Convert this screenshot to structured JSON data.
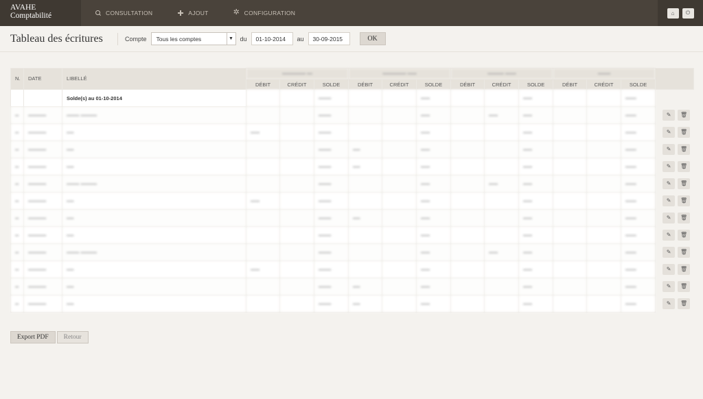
{
  "brand": {
    "line1": "AVAHE",
    "line2": "Comptabilité"
  },
  "nav": [
    {
      "label": "CONSULTATION",
      "icon": "search-icon"
    },
    {
      "label": "AJOUT",
      "icon": "plus-icon"
    },
    {
      "label": "CONFIGURATION",
      "icon": "gear-icon"
    }
  ],
  "toolbar": {
    "title": "Tableau des écritures",
    "compte_label": "Compte",
    "compte_value": "Tous les comptes",
    "du_label": "du",
    "date_from": "01-10-2014",
    "au_label": "au",
    "date_to": "30-09-2015",
    "ok_label": "OK"
  },
  "table": {
    "col_n": "N.",
    "col_date": "DATE",
    "col_libelle": "LIBELLÉ",
    "account_groups": [
      "••••••••••••• •••",
      "••••••••••••• •••••",
      "••••••••• ••••••",
      "•••••••"
    ],
    "sub_cols": [
      "DÉBIT",
      "CRÉDIT",
      "SOLDE"
    ],
    "solde_row_label": "Solde(s) au 01-10-2014",
    "solde_row": [
      "",
      "",
      "•••••••",
      "",
      "",
      "•••••",
      "",
      "",
      "•••••",
      "",
      "",
      "••••••"
    ],
    "rows": [
      {
        "n": "••",
        "date": "••••••••••",
        "lib": "••••••• •••••••••",
        "vals": [
          "",
          "",
          "•••••••",
          "",
          "",
          "•••••",
          "",
          "•••••",
          "•••••",
          "",
          "",
          "••••••"
        ]
      },
      {
        "n": "••",
        "date": "••••••••••",
        "lib": "••••",
        "vals": [
          "•••••",
          "",
          "•••••••",
          "",
          "",
          "•••••",
          "",
          "",
          "•••••",
          "",
          "",
          "••••••"
        ]
      },
      {
        "n": "••",
        "date": "••••••••••",
        "lib": "••••",
        "vals": [
          "",
          "",
          "•••••••",
          "••••",
          "",
          "•••••",
          "",
          "",
          "•••••",
          "",
          "",
          "••••••"
        ]
      },
      {
        "n": "••",
        "date": "••••••••••",
        "lib": "••••",
        "vals": [
          "",
          "",
          "•••••••",
          "••••",
          "",
          "•••••",
          "",
          "",
          "•••••",
          "",
          "",
          "••••••"
        ]
      },
      {
        "n": "••",
        "date": "••••••••••",
        "lib": "••••••• •••••••••",
        "vals": [
          "",
          "",
          "•••••••",
          "",
          "",
          "•••••",
          "",
          "•••••",
          "•••••",
          "",
          "",
          "••••••"
        ]
      },
      {
        "n": "••",
        "date": "••••••••••",
        "lib": "••••",
        "vals": [
          "•••••",
          "",
          "•••••••",
          "",
          "",
          "•••••",
          "",
          "",
          "•••••",
          "",
          "",
          "••••••"
        ]
      },
      {
        "n": "••",
        "date": "••••••••••",
        "lib": "••••",
        "vals": [
          "",
          "",
          "•••••••",
          "••••",
          "",
          "•••••",
          "",
          "",
          "•••••",
          "",
          "",
          "••••••"
        ]
      },
      {
        "n": "••",
        "date": "••••••••••",
        "lib": "••••",
        "vals": [
          "",
          "",
          "•••••••",
          "",
          "",
          "•••••",
          "",
          "",
          "•••••",
          "",
          "",
          "••••••"
        ]
      },
      {
        "n": "••",
        "date": "••••••••••",
        "lib": "••••••• •••••••••",
        "vals": [
          "",
          "",
          "•••••••",
          "",
          "",
          "•••••",
          "",
          "•••••",
          "•••••",
          "",
          "",
          "••••••"
        ]
      },
      {
        "n": "••",
        "date": "••••••••••",
        "lib": "••••",
        "vals": [
          "•••••",
          "",
          "•••••••",
          "",
          "",
          "•••••",
          "",
          "",
          "•••••",
          "",
          "",
          "••••••"
        ]
      },
      {
        "n": "••",
        "date": "••••••••••",
        "lib": "••••",
        "vals": [
          "",
          "",
          "•••••••",
          "••••",
          "",
          "•••••",
          "",
          "",
          "•••••",
          "",
          "",
          "••••••"
        ]
      },
      {
        "n": "••",
        "date": "••••••••••",
        "lib": "••••",
        "vals": [
          "",
          "",
          "•••••••",
          "••••",
          "",
          "•••••",
          "",
          "",
          "•••••",
          "",
          "",
          "••••••"
        ]
      }
    ]
  },
  "actions": {
    "edit_icon": "pencil-icon",
    "delete_icon": "trash-icon"
  },
  "bottom": {
    "export_label": "Export PDF",
    "back_label": "Retour"
  }
}
